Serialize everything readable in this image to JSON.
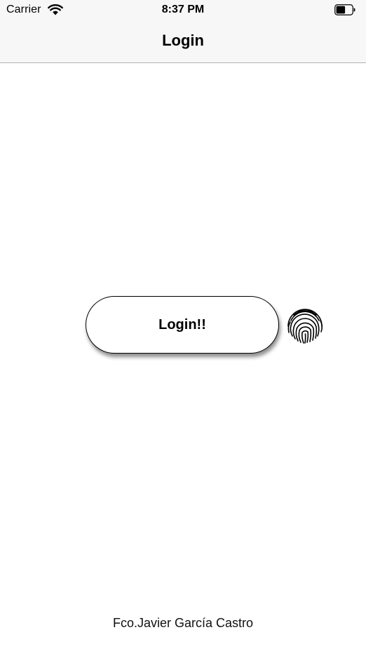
{
  "status_bar": {
    "carrier": "Carrier",
    "time": "8:37 PM",
    "wifi_icon": "wifi-icon",
    "battery_icon": "battery-icon"
  },
  "nav": {
    "title": "Login"
  },
  "main": {
    "login_label": "Login!!",
    "fingerprint_icon": "fingerprint-icon"
  },
  "footer": {
    "author": "Fco.Javier García Castro"
  },
  "colors": {
    "bar_background": "#f7f7f7",
    "divider": "#b2b2b2",
    "button_border": "#000000"
  }
}
